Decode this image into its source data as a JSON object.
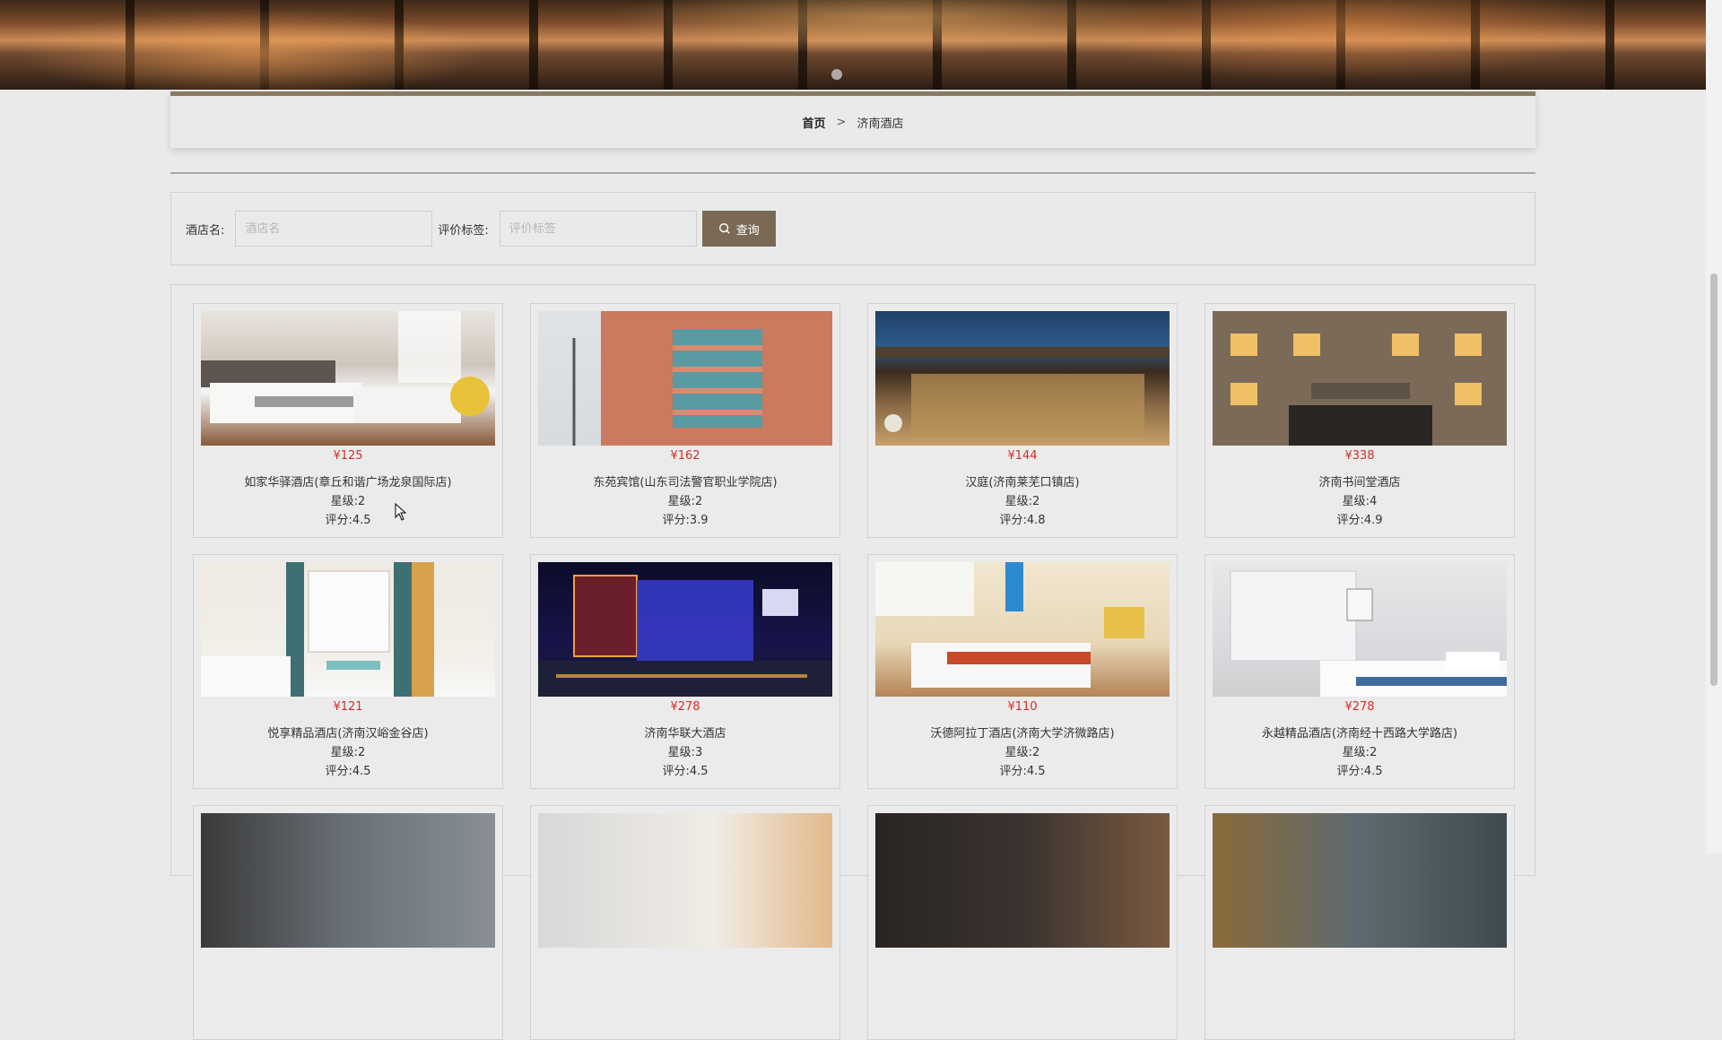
{
  "breadcrumb": {
    "home": "首页",
    "separator": ">",
    "current": "济南酒店"
  },
  "search": {
    "name_label": "酒店名:",
    "name_placeholder": "酒店名",
    "tag_label": "评价标签:",
    "tag_placeholder": "评价标签",
    "button_label": "查询",
    "button_icon": "search-icon"
  },
  "colors": {
    "accent": "#7a6a55",
    "price": "#d0302a",
    "border_top": "#8a7a63"
  },
  "hotels": [
    {
      "price": "¥125",
      "name": "如家华驿酒店(章丘和谐广场龙泉国际店)",
      "stars": "星级:2",
      "score": "评分:4.5"
    },
    {
      "price": "¥162",
      "name": "东苑宾馆(山东司法警官职业学院店)",
      "stars": "星级:2",
      "score": "评分:3.9"
    },
    {
      "price": "¥144",
      "name": "汉庭(济南莱芜口镇店)",
      "stars": "星级:2",
      "score": "评分:4.8"
    },
    {
      "price": "¥338",
      "name": "济南书间堂酒店",
      "stars": "星级:4",
      "score": "评分:4.9"
    },
    {
      "price": "¥121",
      "name": "悦享精品酒店(济南汉峪金谷店)",
      "stars": "星级:2",
      "score": "评分:4.5"
    },
    {
      "price": "¥278",
      "name": "济南华联大酒店",
      "stars": "星级:3",
      "score": "评分:4.5"
    },
    {
      "price": "¥110",
      "name": "沃德阿拉丁酒店(济南大学济微路店)",
      "stars": "星级:2",
      "score": "评分:4.5"
    },
    {
      "price": "¥278",
      "name": "永越精品酒店(济南经十西路大学路店)",
      "stars": "星级:2",
      "score": "评分:4.5"
    },
    {
      "price": "",
      "name": "",
      "stars": "",
      "score": ""
    },
    {
      "price": "",
      "name": "",
      "stars": "",
      "score": ""
    },
    {
      "price": "",
      "name": "",
      "stars": "",
      "score": ""
    },
    {
      "price": "",
      "name": "",
      "stars": "",
      "score": ""
    }
  ]
}
